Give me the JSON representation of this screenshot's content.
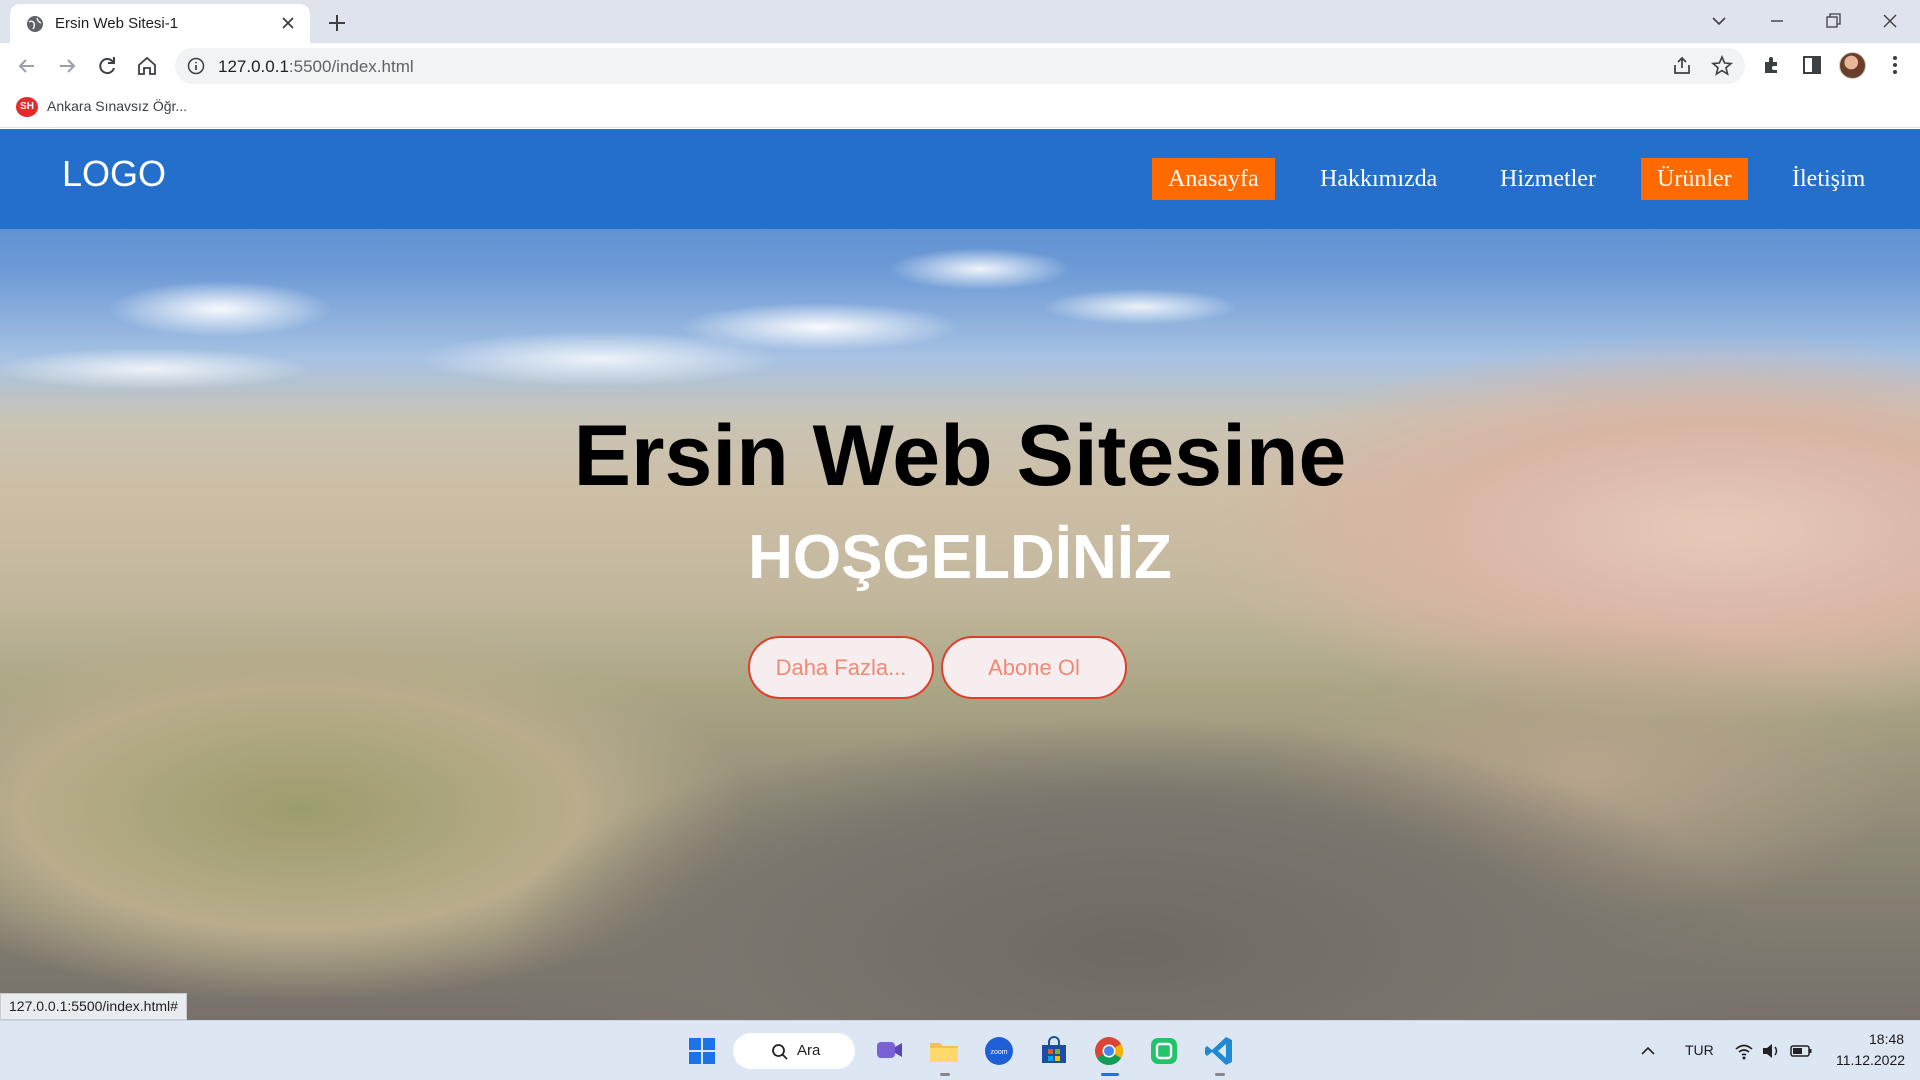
{
  "browser": {
    "tab_title": "Ersin Web Sitesi-1",
    "url_host": "127.0.0.1",
    "url_path": ":5500/index.html",
    "bookmark_label": "Ankara Sınavsız Öğr...",
    "bookmark_icon_text": "SH"
  },
  "page": {
    "logo": "LOGO",
    "nav": [
      {
        "label": "Anasayfa",
        "active": true
      },
      {
        "label": "Hakkımızda",
        "active": false
      },
      {
        "label": "Hizmetler",
        "active": false
      },
      {
        "label": "Ürünler",
        "active": true
      },
      {
        "label": "İletişim",
        "active": false
      }
    ],
    "headline": "Ersin Web Sitesine",
    "subheadline": "HOŞGELDİNİZ",
    "buttons": {
      "more": "Daha Fazla...",
      "subscribe": "Abone Ol"
    },
    "status_url": "127.0.0.1:5500/index.html#",
    "colors": {
      "navbar": "#246fcb",
      "active_nav": "#ff6a00",
      "button_border": "#e23d2a",
      "button_text": "#f28877"
    }
  },
  "taskbar": {
    "search_label": "Ara",
    "language": "TUR",
    "time": "18:48",
    "date": "11.12.2022",
    "icons": [
      "windows-start-icon",
      "search-icon",
      "chat-icon",
      "file-explorer-icon",
      "zoom-icon",
      "store-icon",
      "chrome-icon",
      "app-icon",
      "vscode-icon"
    ]
  }
}
